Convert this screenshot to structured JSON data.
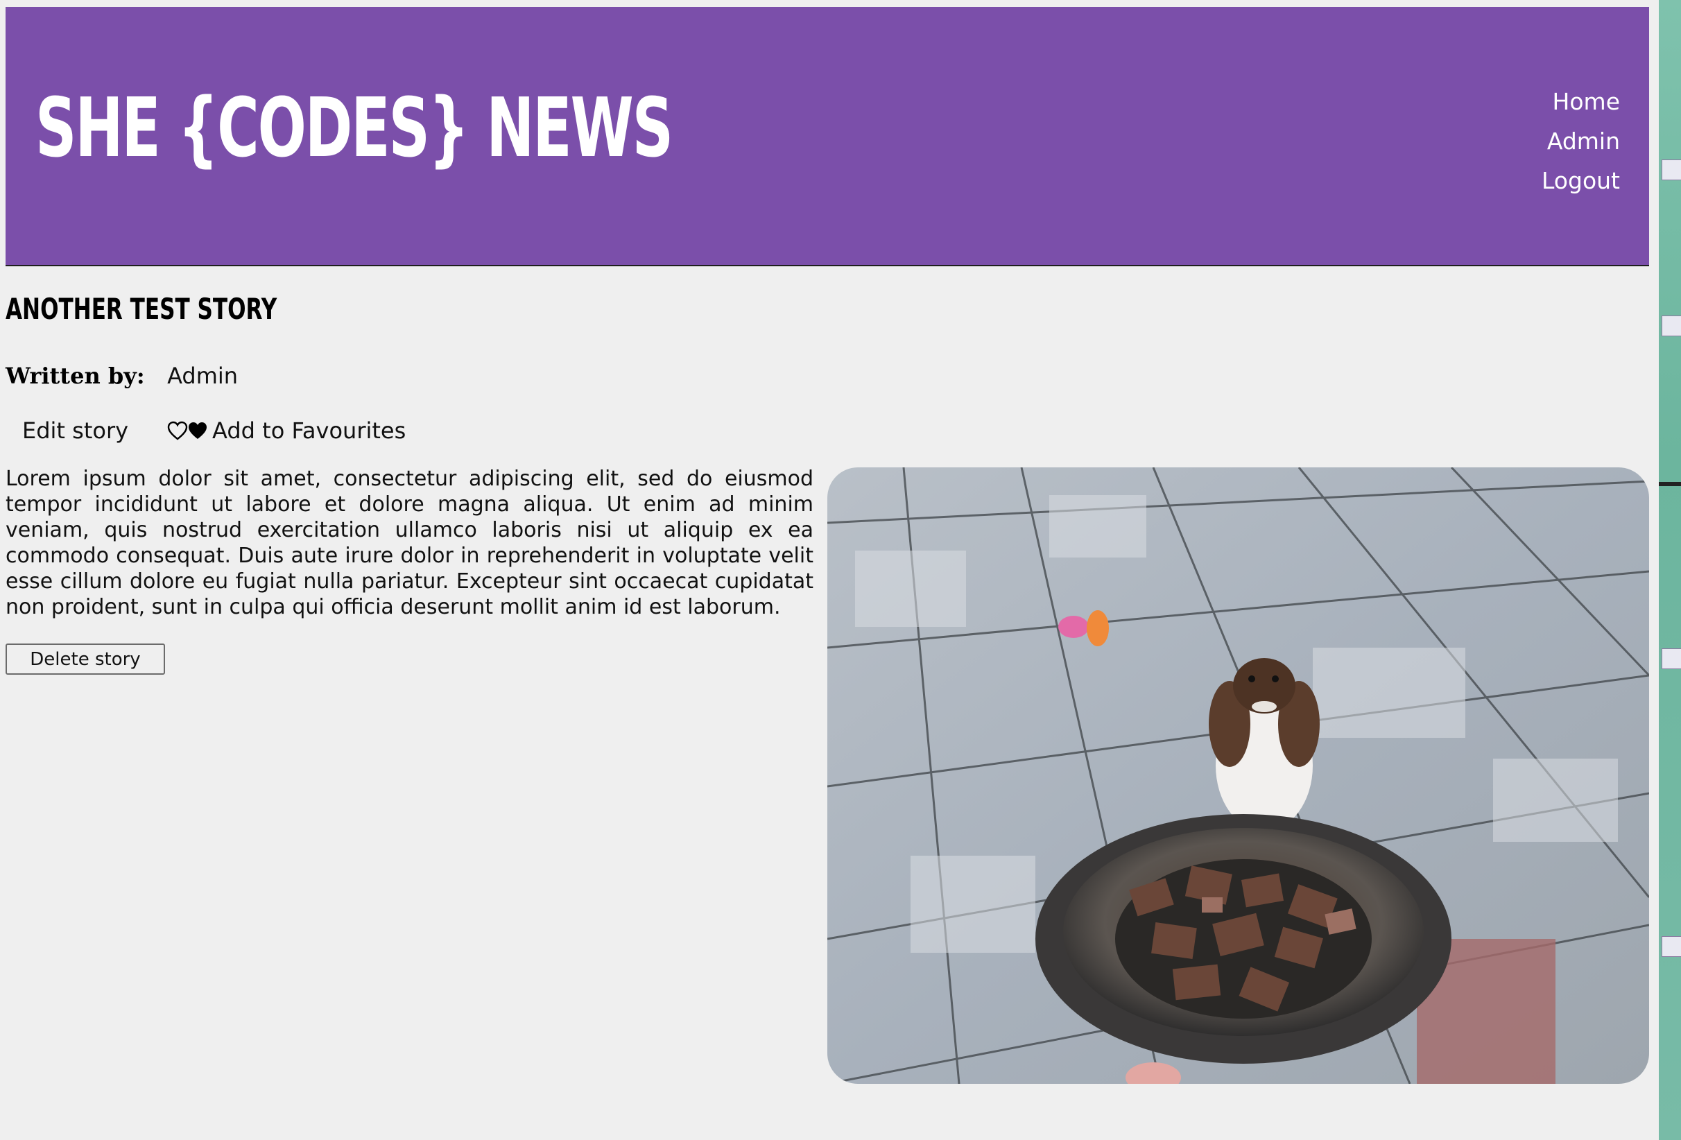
{
  "header": {
    "logo_text": "SHE {CODES} NEWS",
    "brand_color": "#7b4faa",
    "nav": [
      {
        "label": "Home"
      },
      {
        "label": "Admin"
      },
      {
        "label": "Logout"
      }
    ]
  },
  "story": {
    "title": "ANOTHER TEST STORY",
    "byline_label": "Written by:",
    "author": "Admin",
    "edit_label": "Edit story",
    "favourite_label": "Add to Favourites",
    "favourite_icons": [
      "heart-outline-icon",
      "heart-solid-icon"
    ],
    "body": "Lorem ipsum dolor sit amet, consectetur adipiscing elit, sed do eiusmod tempor incididunt ut labore et dolore magna aliqua. Ut enim ad minim veniam, quis nostrud exercitation ullamco laboris nisi ut aliquip ex ea commodo consequat. Duis aute irure dolor in reprehenderit in voluptate velit esse cillum dolore eu fugiat nulla pariatur. Excepteur sint occaecat cupidatat non proident, sunt in culpa qui officia deserunt mollit anim id est laborum.",
    "delete_label": "Delete story",
    "image_subject": "dog-with-food-bowl-photo"
  }
}
